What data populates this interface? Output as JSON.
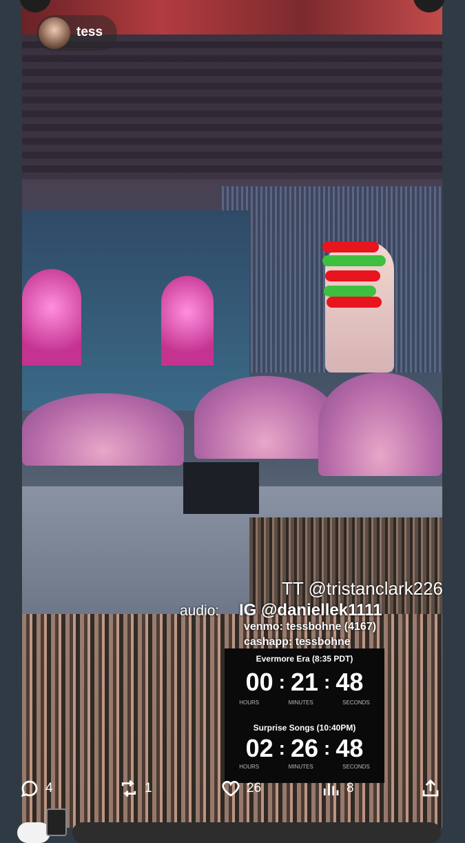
{
  "post": {
    "username": "tess"
  },
  "overlay": {
    "tiktok": "TT @tristanclark226",
    "audio_label": "audio:",
    "instagram": "IG @daniellek1111",
    "venmo": "venmo: tessbohne (4167)",
    "cashapp": "cashapp: tessbohne"
  },
  "timers": [
    {
      "title": "Evermore Era (8:35 PDT)",
      "hours": "00",
      "minutes": "21",
      "seconds": "48",
      "labels": [
        "HOURS",
        "MINUTES",
        "SECONDS"
      ]
    },
    {
      "title": "Surprise Songs (10:40PM)",
      "hours": "02",
      "minutes": "26",
      "seconds": "48",
      "labels": [
        "HOURS",
        "MINUTES",
        "SECONDS"
      ]
    }
  ],
  "actions": {
    "replies": "4",
    "reposts": "1",
    "likes": "26",
    "views": "8"
  },
  "icons": [
    "reply-icon",
    "repost-icon",
    "like-icon",
    "views-icon",
    "share-icon"
  ],
  "colors": {
    "scribble_red": "#e8141e",
    "scribble_green": "#3fbf3f",
    "timer_bg": "#0a0a0a",
    "page_bg": "#2f3a45"
  }
}
